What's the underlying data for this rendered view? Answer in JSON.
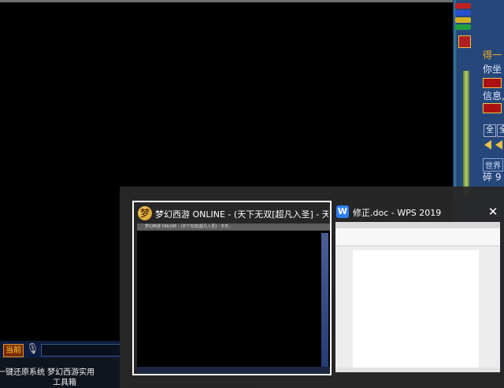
{
  "game": {
    "bottom_bar": {
      "current_label": "当前"
    },
    "side_panel": {
      "texts": [
        "得一",
        "你坐",
        "信息,",
        "世界",
        "碎 9"
      ],
      "chips": [
        "全",
        "全"
      ]
    }
  },
  "taskbar": {
    "app_label_line1": "一键还原系统 梦幻西游实用",
    "app_label_line2": "工具箱"
  },
  "switcher": {
    "windows": [
      {
        "icon": "dragon-game-icon",
        "title": "梦幻西游 ONLINE - (天下无双[超凡入圣] - 天冬...",
        "thumb_title": "梦幻西游 ONLINE - (天下无双[超凡入圣] - 天冬...",
        "selected": true
      },
      {
        "icon": "wps-writer-icon",
        "icon_glyph": "W",
        "title": "修正.doc - WPS 2019",
        "selected": false
      }
    ],
    "close_glyph": "✕"
  }
}
